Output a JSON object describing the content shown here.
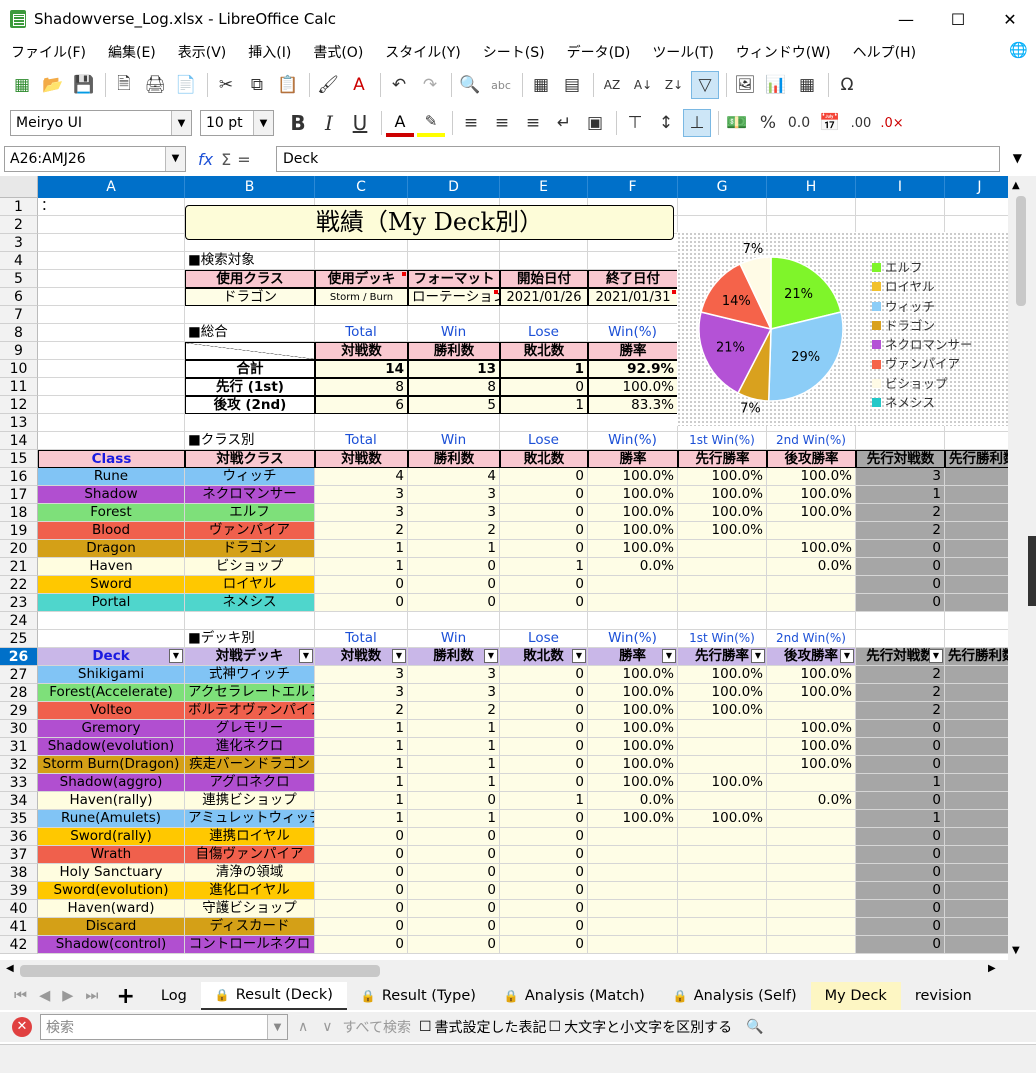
{
  "window": {
    "title": "Shadowverse_Log.xlsx - LibreOffice Calc"
  },
  "menu": [
    "ファイル(F)",
    "編集(E)",
    "表示(V)",
    "挿入(I)",
    "書式(O)",
    "スタイル(Y)",
    "シート(S)",
    "データ(D)",
    "ツール(T)",
    "ウィンドウ(W)",
    "ヘルプ(H)"
  ],
  "toolbar2": {
    "font_name": "Meiryo UI",
    "font_size": "10 pt"
  },
  "formula": {
    "name_box": "A26:AMJ26",
    "content": "Deck"
  },
  "columns": [
    "A",
    "B",
    "C",
    "D",
    "E",
    "F",
    "G",
    "H",
    "I",
    "J"
  ],
  "rows": [
    "1",
    "2",
    "3",
    "4",
    "5",
    "6",
    "7",
    "8",
    "9",
    "10",
    "11",
    "12",
    "13",
    "14",
    "15",
    "16",
    "17",
    "18",
    "19",
    "20",
    "21",
    "22",
    "23",
    "24",
    "25",
    "26",
    "27",
    "28",
    "29",
    "30",
    "31",
    "32",
    "33",
    "34",
    "35",
    "36",
    "37",
    "38",
    "39",
    "40",
    "41",
    "42"
  ],
  "sheet": {
    "a1": "：",
    "title": "戦績（My Deck別）",
    "search_label": "■検索対象",
    "search_headers": [
      "使用クラス",
      "使用デッキ",
      "フォーマット",
      "開始日付",
      "終了日付"
    ],
    "search_values": [
      "ドラゴン",
      "Storm / Burn",
      "ローテーション",
      "2021/01/26",
      "2021/01/31"
    ],
    "total_label": "■総合",
    "en_headers": [
      "Total",
      "Win",
      "Lose",
      "Win(%)"
    ],
    "en_headers2": [
      "Total",
      "Win",
      "Lose",
      "Win(%)",
      "1st  Win(%)",
      "2nd Win(%)"
    ],
    "jp_headers": [
      "対戦数",
      "勝利数",
      "敗北数",
      "勝率"
    ],
    "total_rows": [
      {
        "label": "合計",
        "total": "14",
        "win": "13",
        "lose": "1",
        "pct": "92.9%"
      },
      {
        "label": "先行 (1st)",
        "total": "8",
        "win": "8",
        "lose": "0",
        "pct": "100.0%"
      },
      {
        "label": "後攻 (2nd)",
        "total": "6",
        "win": "5",
        "lose": "1",
        "pct": "83.3%"
      }
    ],
    "class_label": "■クラス別",
    "class_headers": [
      "Class",
      "対戦クラス",
      "対戦数",
      "勝利数",
      "敗北数",
      "勝率",
      "先行勝率",
      "後攻勝率",
      "先行対戦数",
      "先行勝利数"
    ],
    "class_rows": [
      {
        "a": "Rune",
        "b": "ウィッチ",
        "c": "4",
        "d": "4",
        "e": "0",
        "f": "100.0%",
        "g": "100.0%",
        "h": "100.0%",
        "i": "3"
      },
      {
        "a": "Shadow",
        "b": "ネクロマンサー",
        "c": "3",
        "d": "3",
        "e": "0",
        "f": "100.0%",
        "g": "100.0%",
        "h": "100.0%",
        "i": "1"
      },
      {
        "a": "Forest",
        "b": "エルフ",
        "c": "3",
        "d": "3",
        "e": "0",
        "f": "100.0%",
        "g": "100.0%",
        "h": "100.0%",
        "i": "2"
      },
      {
        "a": "Blood",
        "b": "ヴァンパイア",
        "c": "2",
        "d": "2",
        "e": "0",
        "f": "100.0%",
        "g": "100.0%",
        "h": "",
        "i": "2"
      },
      {
        "a": "Dragon",
        "b": "ドラゴン",
        "c": "1",
        "d": "1",
        "e": "0",
        "f": "100.0%",
        "g": "",
        "h": "100.0%",
        "i": "0"
      },
      {
        "a": "Haven",
        "b": "ビショップ",
        "c": "1",
        "d": "0",
        "e": "1",
        "f": "0.0%",
        "g": "",
        "h": "0.0%",
        "i": "0"
      },
      {
        "a": "Sword",
        "b": "ロイヤル",
        "c": "0",
        "d": "0",
        "e": "0",
        "f": "",
        "g": "",
        "h": "",
        "i": "0"
      },
      {
        "a": "Portal",
        "b": "ネメシス",
        "c": "0",
        "d": "0",
        "e": "0",
        "f": "",
        "g": "",
        "h": "",
        "i": "0"
      }
    ],
    "deck_label": "■デッキ別",
    "deck_headers": [
      "Deck",
      "対戦デッキ",
      "対戦数",
      "勝利数",
      "敗北数",
      "勝率",
      "先行勝率",
      "後攻勝率",
      "先行対戦数",
      "先行勝利数"
    ],
    "deck_rows": [
      {
        "a": "Shikigami",
        "b": "式神ウィッチ",
        "c": "3",
        "d": "3",
        "e": "0",
        "f": "100.0%",
        "g": "100.0%",
        "h": "100.0%",
        "i": "2"
      },
      {
        "a": "Forest(Accelerate)",
        "b": "アクセラレートエルフ",
        "c": "3",
        "d": "3",
        "e": "0",
        "f": "100.0%",
        "g": "100.0%",
        "h": "100.0%",
        "i": "2"
      },
      {
        "a": "Volteo",
        "b": "ボルテオヴァンパイア",
        "c": "2",
        "d": "2",
        "e": "0",
        "f": "100.0%",
        "g": "100.0%",
        "h": "",
        "i": "2"
      },
      {
        "a": "Gremory",
        "b": "グレモリー",
        "c": "1",
        "d": "1",
        "e": "0",
        "f": "100.0%",
        "g": "",
        "h": "100.0%",
        "i": "0"
      },
      {
        "a": "Shadow(evolution)",
        "b": "進化ネクロ",
        "c": "1",
        "d": "1",
        "e": "0",
        "f": "100.0%",
        "g": "",
        "h": "100.0%",
        "i": "0"
      },
      {
        "a": "Storm Burn(Dragon)",
        "b": "疾走バーンドラゴン",
        "c": "1",
        "d": "1",
        "e": "0",
        "f": "100.0%",
        "g": "",
        "h": "100.0%",
        "i": "0"
      },
      {
        "a": "Shadow(aggro)",
        "b": "アグロネクロ",
        "c": "1",
        "d": "1",
        "e": "0",
        "f": "100.0%",
        "g": "100.0%",
        "h": "",
        "i": "1"
      },
      {
        "a": "Haven(rally)",
        "b": "連携ビショップ",
        "c": "1",
        "d": "0",
        "e": "1",
        "f": "0.0%",
        "g": "",
        "h": "0.0%",
        "i": "0"
      },
      {
        "a": "Rune(Amulets)",
        "b": "アミュレットウィッチ",
        "c": "1",
        "d": "1",
        "e": "0",
        "f": "100.0%",
        "g": "100.0%",
        "h": "",
        "i": "1"
      },
      {
        "a": "Sword(rally)",
        "b": "連携ロイヤル",
        "c": "0",
        "d": "0",
        "e": "0",
        "f": "",
        "g": "",
        "h": "",
        "i": "0"
      },
      {
        "a": "Wrath",
        "b": "自傷ヴァンパイア",
        "c": "0",
        "d": "0",
        "e": "0",
        "f": "",
        "g": "",
        "h": "",
        "i": "0"
      },
      {
        "a": "Holy Sanctuary",
        "b": "清浄の領域",
        "c": "0",
        "d": "0",
        "e": "0",
        "f": "",
        "g": "",
        "h": "",
        "i": "0"
      },
      {
        "a": "Sword(evolution)",
        "b": "進化ロイヤル",
        "c": "0",
        "d": "0",
        "e": "0",
        "f": "",
        "g": "",
        "h": "",
        "i": "0"
      },
      {
        "a": "Haven(ward)",
        "b": "守護ビショップ",
        "c": "0",
        "d": "0",
        "e": "0",
        "f": "",
        "g": "",
        "h": "",
        "i": "0"
      },
      {
        "a": "Discard",
        "b": "ディスカード",
        "c": "0",
        "d": "0",
        "e": "0",
        "f": "",
        "g": "",
        "h": "",
        "i": "0"
      },
      {
        "a": "Shadow(control)",
        "b": "コントロールネクロ",
        "c": "0",
        "d": "0",
        "e": "0",
        "f": "",
        "g": "",
        "h": "",
        "i": "0"
      }
    ]
  },
  "colors": {
    "rune": "#81c4f5",
    "shadow": "#b14fd0",
    "forest": "#7ee07a",
    "blood": "#f0604c",
    "dragon": "#d4a017",
    "haven": "#fffde0",
    "sword": "#ffc800",
    "portal": "#4fd6cc",
    "header_pink": "#f9c8d0",
    "cream": "#fefde6",
    "header_lavender": "#c9b7e8",
    "gray": "#a6a6a6"
  },
  "chart_data": {
    "type": "pie",
    "labels": [
      "エルフ",
      "ロイヤル",
      "ウィッチ",
      "ドラゴン",
      "ネクロマンサー",
      "ヴァンパイア",
      "ビショップ",
      "ネメシス"
    ],
    "values": [
      21,
      0,
      29,
      7,
      21,
      14,
      7,
      0
    ],
    "value_labels": [
      "21%",
      "",
      "29%",
      "7%",
      "21%",
      "14%",
      "7%",
      ""
    ],
    "colors": [
      "#7ff52a",
      "#f2c12e",
      "#8ccdf7",
      "#d9a11e",
      "#b452d6",
      "#f5634a",
      "#fffbe6",
      "#23c8c8"
    ],
    "legend": "right"
  },
  "tabs": [
    "Log",
    "Result (Deck)",
    "Result (Type)",
    "Analysis (Match)",
    "Analysis (Self)",
    "My Deck",
    "revision"
  ],
  "find": {
    "placeholder": "検索",
    "find_all": "すべて検索",
    "opt1": "書式設定した表記",
    "opt2": "大文字と小文字を区別する"
  }
}
